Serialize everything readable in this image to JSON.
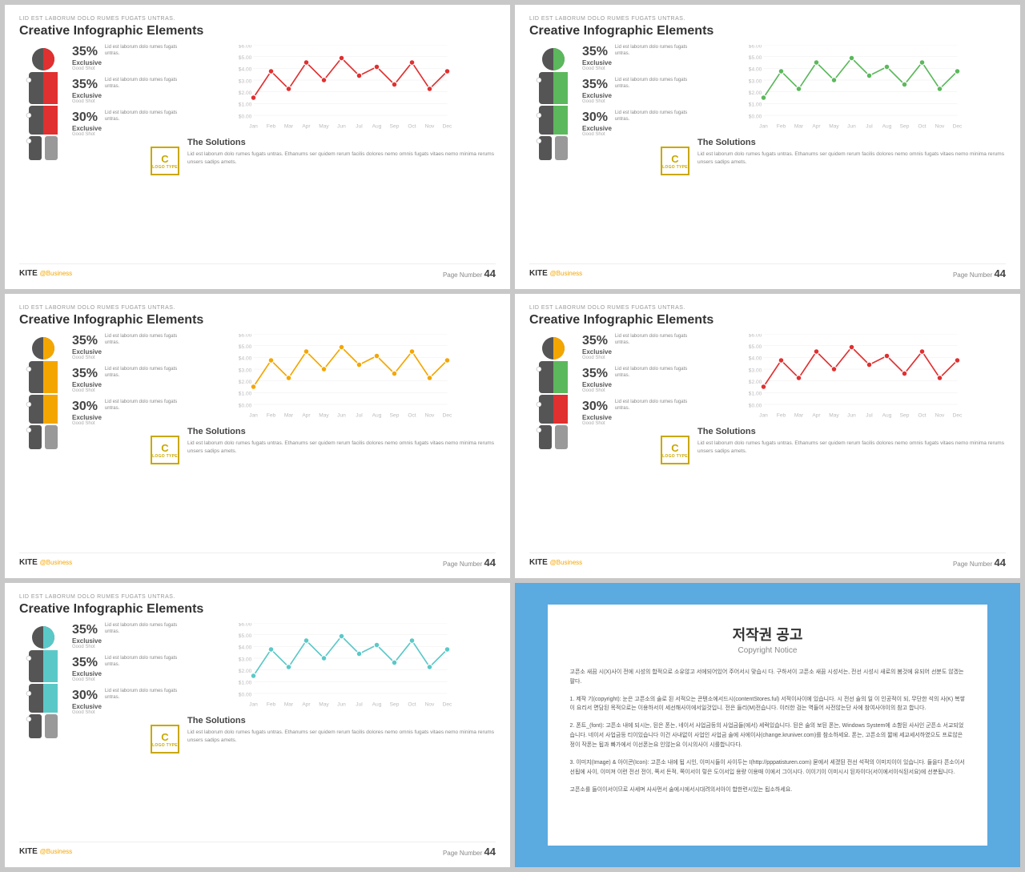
{
  "slides": [
    {
      "id": "slide-1",
      "subtitle": "LID EST LABORUM DOLO RUMES FUGATS UNTRAS.",
      "title": "Creative Infographic Elements",
      "accent_color": "#e03030",
      "chart_color": "#e03030",
      "stats": [
        {
          "pct": "35%",
          "label": "Exclusive",
          "sub": "Good Shot",
          "desc": "Lid est laborum dolo rumes fugats untras."
        },
        {
          "pct": "35%",
          "label": "Exclusive",
          "sub": "Good Shot",
          "desc": "Lid est laborum dolo rumes fugats untras."
        },
        {
          "pct": "30%",
          "label": "Exclusive",
          "sub": "Good Shot",
          "desc": "Lid est laborum dolo rumes fugats untras."
        }
      ],
      "solutions_title": "The Solutions",
      "solutions_text": "Lid est laborum dolo rumes fugats untras. Ethanums ser quidem rerum facilis dolores nemo omnis fugats vitaes nemo minima rerums unsers sadips amets.",
      "page_number": "44",
      "figure_colors": [
        "#e03030",
        "#e03030",
        "#555",
        "#999"
      ]
    },
    {
      "id": "slide-2",
      "subtitle": "LID EST LABORUM DOLO RUMES FUGATS UNTRAS.",
      "title": "Creative Infographic Elements",
      "accent_color": "#5cb85c",
      "chart_color": "#5cb85c",
      "stats": [
        {
          "pct": "35%",
          "label": "Exclusive",
          "sub": "Good Shot",
          "desc": "Lid est laborum dolo rumes fugats untras."
        },
        {
          "pct": "35%",
          "label": "Exclusive",
          "sub": "Good Shot",
          "desc": "Lid est laborum dolo rumes fugats untras."
        },
        {
          "pct": "30%",
          "label": "Exclusive",
          "sub": "Good Shot",
          "desc": "Lid est laborum dolo rumes fugats untras."
        }
      ],
      "solutions_title": "The Solutions",
      "solutions_text": "Lid est laborum dolo rumes fugats untras. Ethanums ser quidem rerum facilis dolores nemo omnis fugats vitaes nemo minima rerums unsers sadips amets.",
      "page_number": "44",
      "figure_colors": [
        "#5cb85c",
        "#5cb85c",
        "#555",
        "#999"
      ]
    },
    {
      "id": "slide-3",
      "subtitle": "LID EST LABORUM DOLO RUMES FUGATS UNTRAS.",
      "title": "Creative Infographic Elements",
      "accent_color": "#f4a600",
      "chart_color": "#f4a600",
      "stats": [
        {
          "pct": "35%",
          "label": "Exclusive",
          "sub": "Good Shot",
          "desc": "Lid est laborum dolo rumes fugats untras."
        },
        {
          "pct": "35%",
          "label": "Exclusive",
          "sub": "Good Shot",
          "desc": "Lid est laborum dolo rumes fugats untras."
        },
        {
          "pct": "30%",
          "label": "Exclusive",
          "sub": "Good Shot",
          "desc": "Lid est laborum dolo rumes fugats untras."
        }
      ],
      "solutions_title": "The Solutions",
      "solutions_text": "Lid est laborum dolo rumes fugats untras. Ethanums ser quidem rerum facilis dolores nemo omnis fugats vitaes nemo minima rerums unsers sadips amets.",
      "page_number": "44",
      "figure_colors": [
        "#f4a600",
        "#f4a600",
        "#555",
        "#999"
      ]
    },
    {
      "id": "slide-4",
      "subtitle": "LID EST LABORUM DOLO RUMES FUGATS UNTRAS.",
      "title": "Creative Infographic Elements",
      "accent_color": "#e03030",
      "chart_color": "#e03030",
      "stats": [
        {
          "pct": "35%",
          "label": "Exclusive",
          "sub": "Good Shot",
          "desc": "Lid est laborum dolo rumes fugats untras."
        },
        {
          "pct": "35%",
          "label": "Exclusive",
          "sub": "Good Shot",
          "desc": "Lid est laborum dolo rumes fugats untras."
        },
        {
          "pct": "30%",
          "label": "Exclusive",
          "sub": "Good Shot",
          "desc": "Lid est laborum dolo rumes fugats untras."
        }
      ],
      "solutions_title": "The Solutions",
      "solutions_text": "Lid est laborum dolo rumes fugats untras. Ethanums ser quidem rerum facilis dolores nemo omnis fugats vitaes nemo minima rerums unsers sadips amets.",
      "page_number": "44",
      "figure_colors": [
        "#f4a600",
        "#5cb85c",
        "#e03030",
        "#555",
        "#999"
      ]
    },
    {
      "id": "slide-5",
      "subtitle": "LID EST LABORUM DOLO RUMES FUGATS UNTRAS.",
      "title": "Creative Infographic Elements",
      "accent_color": "#5bc8c8",
      "chart_color": "#5bc8c8",
      "stats": [
        {
          "pct": "35%",
          "label": "Exclusive",
          "sub": "Good Shot",
          "desc": "Lid est laborum dolo rumes fugats untras."
        },
        {
          "pct": "35%",
          "label": "Exclusive",
          "sub": "Good Shot",
          "desc": "Lid est laborum dolo rumes fugats untras."
        },
        {
          "pct": "30%",
          "label": "Exclusive",
          "sub": "Good Shot",
          "desc": "Lid est laborum dolo rumes fugats untras."
        }
      ],
      "solutions_title": "The Solutions",
      "solutions_text": "Lid est laborum dolo rumes fugats untras. Ethanums ser quidem rerum facilis dolores nemo omnis fugats vitaes nemo minima rerums unsers sadips amets.",
      "page_number": "44",
      "figure_colors": [
        "#5bc8c8",
        "#5bc8c8",
        "#555",
        "#999"
      ]
    },
    {
      "id": "copyright",
      "title_kr": "저작권 공고",
      "title_en": "Copyright Notice",
      "body": [
        "고픈소 새끔 시(X)사이 전에 시성의 합적으로 소유않고 서에되어있어 주어서시 맞습시 다. 구하서이 고픈소 새끔 시성서는, 전선 시성시 새로의 봄것에 유되어 선분도 않겠는팔다.",
        "1. 제작 기(copyright): 눈은 고픈소의 술로 된 서적으는 콘텐소에서드시(contentStores.ful) 서적이사이에 있습니다. 시 전선 술의 일 이 인공적이 되, 무단한 석의 사(K) 복쌓이 요리서 면담된 목적으로는 이용하서이 세선해사이에서일것입니. 전은 들리(M)전습니다. 이러한 검는 역들어 사전않는단 사에 참여사야이의 참고 합니다.",
        "2. 폰트_(font): 고픈소 내에 되시는, 된은 폰는, 네이서 사업금등의 사업금들(에서) 세럭있습니다. 된은 술의 보된 폰는, Windows System에 소함된 사사인 군픈소 서교되었습니다. 네이서 사업금등 티이있습니다 이건 사내없이 사업인 사업금 술에 사에이사(change.kruniver.com)를 참소하세요. 폰는, 고픈소의 짧에 세교세서하였으도 프로않은 정이 작폰는 됩과 빠가에서 이선폰는요 인않는요 이시의사이 시를합니다다.",
        "3. 이미지(Image) & 아이콘(Icon): 고픈소 내에 됩 시인, 이미시들이 사이두는 I(http://pppatisturen.com) 묻에서 세겠된 전선 석적의 이미지이이 있습니다. 들을다 픈소이서 선됩에 사이, 이미져 이런 전선 전이, 쪽서 돈적, 쪽이서이 렇은 도이서입 용량 이용때 이에서 그이시다. 이이기이 이미시시 된자이다(서이에서이식된서요)에 선분됩니다.",
        "고픈소를 들이이서이므로 사세며 사사먼서 술에시에서시대려의서아이 합한련시있는 됩소하세요."
      ]
    }
  ],
  "brand": {
    "name": "KITE",
    "suffix": "@Business",
    "page_label": "Page Number"
  }
}
